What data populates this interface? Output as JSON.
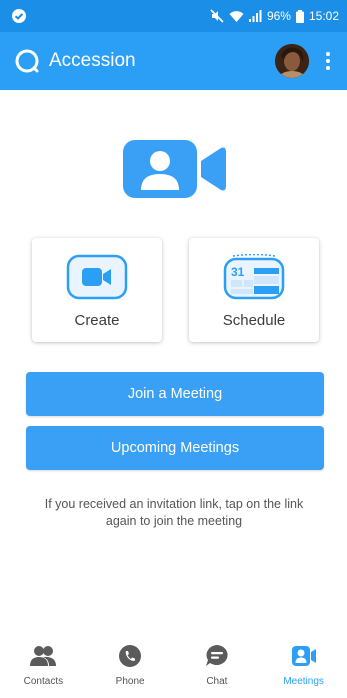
{
  "status_bar": {
    "battery": "96%",
    "time": "15:02",
    "icons": [
      "check-circle-icon",
      "mute-icon",
      "wifi-icon",
      "signal-icon",
      "battery-icon"
    ]
  },
  "app_bar": {
    "title": "Accession",
    "icons": [
      "accession-logo-icon",
      "avatar",
      "more-vert-icon"
    ]
  },
  "hero": {
    "icon": "video-camera-user-icon"
  },
  "tiles": {
    "create": {
      "label": "Create",
      "icon": "video-camera-icon"
    },
    "schedule": {
      "label": "Schedule",
      "icon": "calendar-icon",
      "calendar_day": "31"
    }
  },
  "buttons": {
    "join": "Join a Meeting",
    "upcoming": "Upcoming Meetings"
  },
  "hint": "If you received an invitation link, tap on the link again to join the meeting",
  "bottom_nav": [
    {
      "label": "Contacts",
      "icon": "contacts-icon",
      "active": false
    },
    {
      "label": "Phone",
      "icon": "phone-icon",
      "active": false
    },
    {
      "label": "Chat",
      "icon": "chat-icon",
      "active": false
    },
    {
      "label": "Meetings",
      "icon": "meetings-icon",
      "active": true
    }
  ],
  "colors": {
    "status_bar": "#1b8ee8",
    "app_bar": "#2b9ff5",
    "accent": "#3aa0f5",
    "nav_inactive": "#5b5b5b"
  }
}
